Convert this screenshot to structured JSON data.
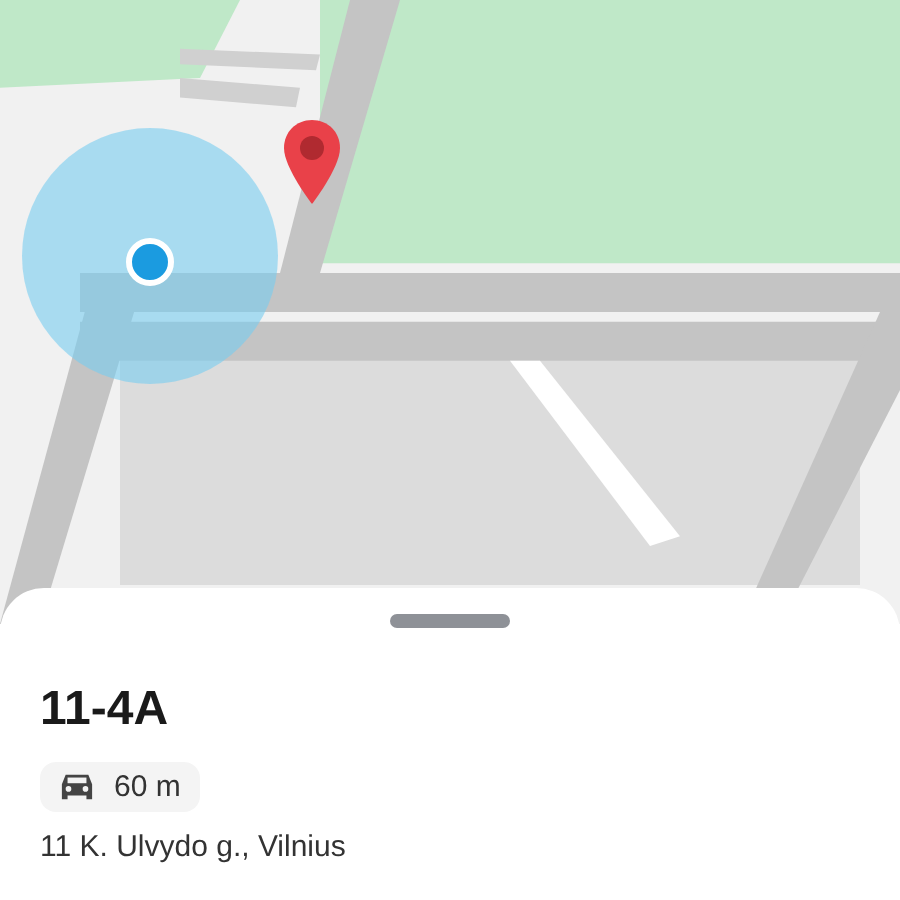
{
  "place": {
    "title": "11-4A",
    "travel": {
      "kind": "car",
      "distance": "60 m"
    },
    "address": "11 K. Ulvydo g., Vilnius"
  }
}
